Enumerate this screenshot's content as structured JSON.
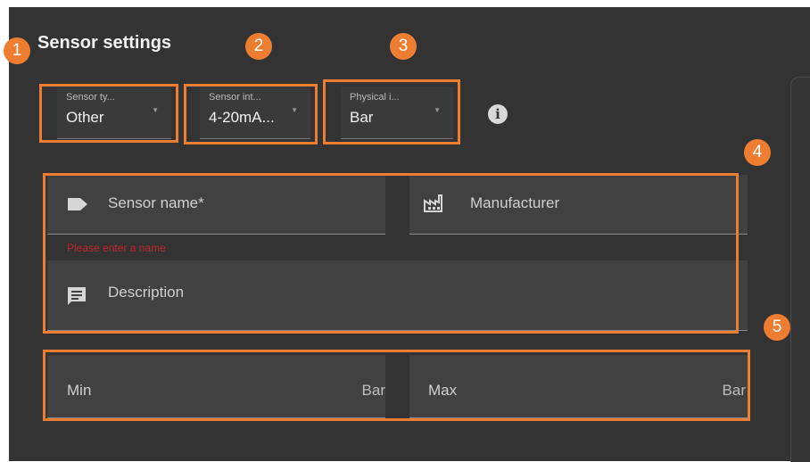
{
  "title": "Sensor settings",
  "selects": [
    {
      "label": "Sensor ty...",
      "value": "Other"
    },
    {
      "label": "Sensor int...",
      "value": "4-20mA..."
    },
    {
      "label": "Physical i...",
      "value": "Bar"
    }
  ],
  "fields": {
    "sensor_name": "Sensor name*",
    "manufacturer": "Manufacturer",
    "error": "Please enter a name",
    "description": "Description",
    "min": "Min",
    "min_unit": "Bar",
    "max": "Max",
    "max_unit": "Bar"
  },
  "annotations": [
    "1",
    "2",
    "3",
    "4",
    "5"
  ],
  "colors": {
    "accent": "#ed7d31",
    "panel": "#333333",
    "error": "#c4262e"
  },
  "icons": [
    "tag-icon",
    "factory-icon",
    "comment-icon",
    "info-icon",
    "dropdown-caret-icon"
  ]
}
